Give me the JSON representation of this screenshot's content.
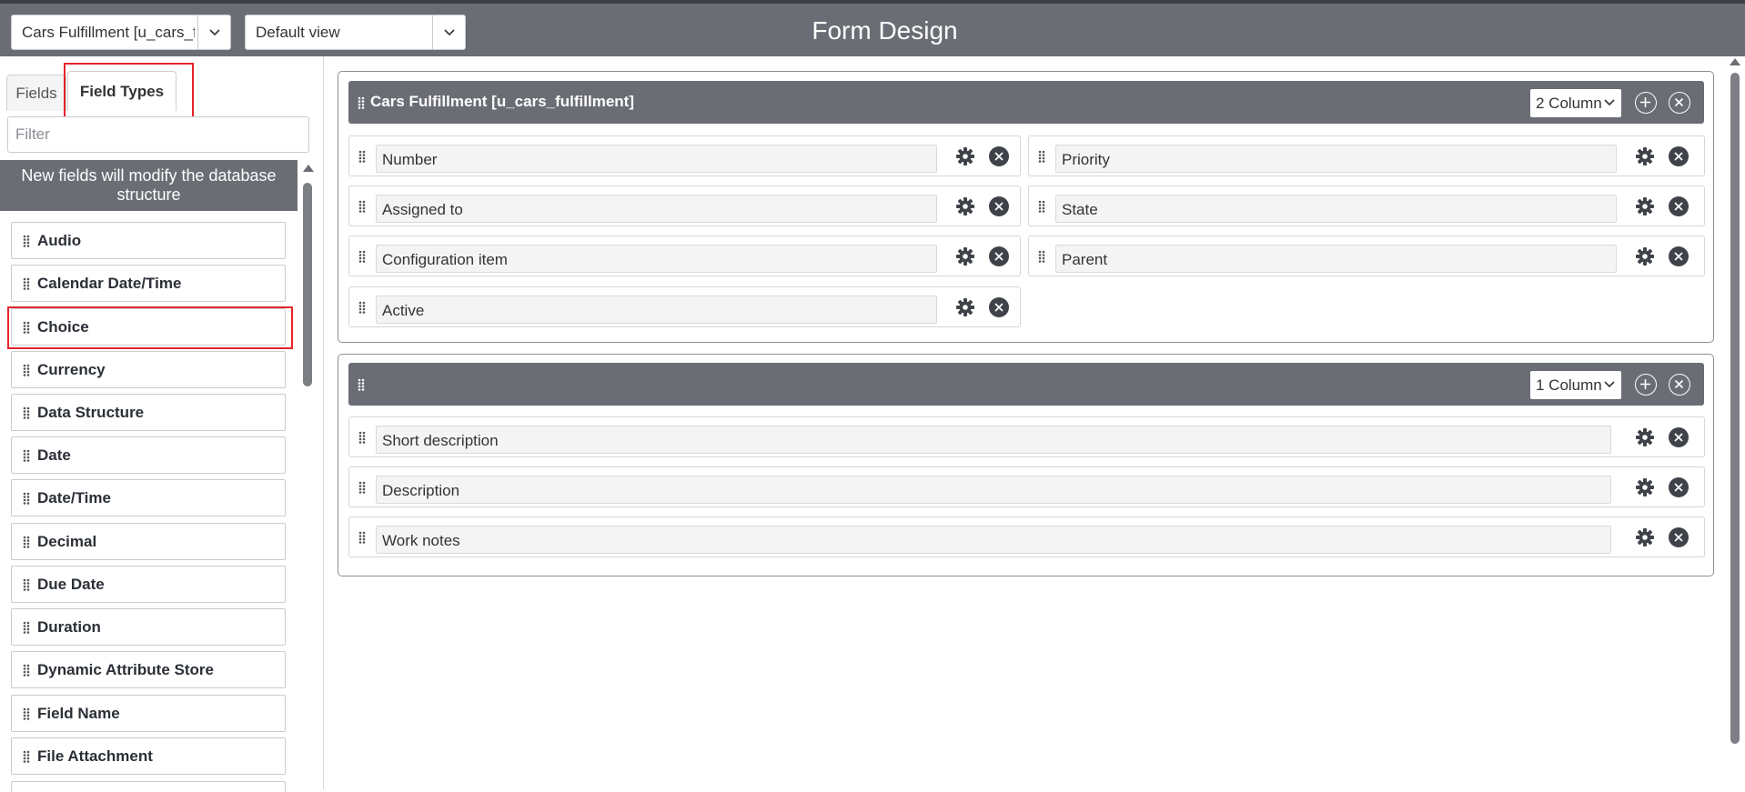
{
  "topbar": {
    "table_select": "Cars Fulfillment [u_cars_fulfillment]",
    "view_select": "Default view",
    "title": "Form Design"
  },
  "left_panel": {
    "tabs": [
      {
        "label": "Fields",
        "active": false
      },
      {
        "label": "Field Types",
        "active": true
      }
    ],
    "filter_placeholder": "Filter",
    "notice": "New fields will modify the database structure",
    "field_types": [
      {
        "label": "Audio"
      },
      {
        "label": "Calendar Date/Time"
      },
      {
        "label": "Choice"
      },
      {
        "label": "Currency"
      },
      {
        "label": "Data Structure"
      },
      {
        "label": "Date"
      },
      {
        "label": "Date/Time"
      },
      {
        "label": "Decimal"
      },
      {
        "label": "Due Date"
      },
      {
        "label": "Duration"
      },
      {
        "label": "Dynamic Attribute Store"
      },
      {
        "label": "Field Name"
      },
      {
        "label": "File Attachment"
      }
    ],
    "highlighted_item": "Choice"
  },
  "sections": [
    {
      "title": "Cars Fulfillment [u_cars_fulfillment]",
      "columns_label": "2 Column",
      "fields": [
        {
          "label": "Number"
        },
        {
          "label": "Priority"
        },
        {
          "label": "Assigned to"
        },
        {
          "label": "State"
        },
        {
          "label": "Configuration item"
        },
        {
          "label": "Parent"
        },
        {
          "label": "Active"
        }
      ]
    },
    {
      "title": "",
      "columns_label": "1 Column",
      "fields": [
        {
          "label": "Short description"
        },
        {
          "label": "Description"
        },
        {
          "label": "Work notes"
        }
      ]
    }
  ],
  "colors": {
    "header_gray": "#6b6d75",
    "highlight_red": "#e5252a",
    "icon_dark": "#3f4349"
  },
  "icons": [
    "chevron-down-icon",
    "drag-handle-icon",
    "gear-icon",
    "close-circle-icon",
    "add-circle-icon"
  ]
}
